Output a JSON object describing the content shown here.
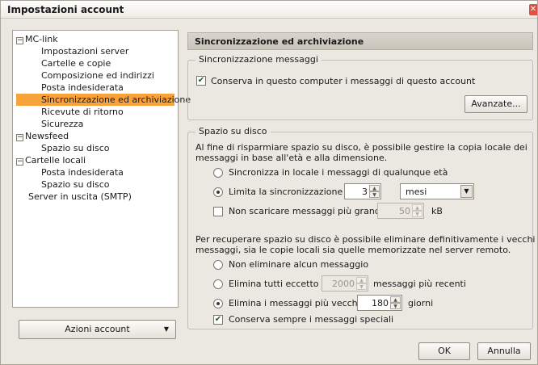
{
  "window": {
    "title": "Impostazioni account",
    "close_glyph": "✕"
  },
  "tree": {
    "items": [
      {
        "label": "MC-link",
        "toggle": "−"
      },
      {
        "label": "Impostazioni server"
      },
      {
        "label": "Cartelle e copie"
      },
      {
        "label": "Composizione ed indirizzi"
      },
      {
        "label": "Posta indesiderata"
      },
      {
        "label": "Sincronizzazione ed archiviazione",
        "selected": true
      },
      {
        "label": "Ricevute di ritorno"
      },
      {
        "label": "Sicurezza"
      },
      {
        "label": "Newsfeed",
        "toggle": "−"
      },
      {
        "label": "Spazio su disco"
      },
      {
        "label": "Cartelle locali",
        "toggle": "−"
      },
      {
        "label": "Posta indesiderata"
      },
      {
        "label": "Spazio su disco"
      },
      {
        "label": "Server in uscita (SMTP)"
      }
    ]
  },
  "account_actions": {
    "label": "Azioni account",
    "caret": "▼"
  },
  "panel": {
    "title": "Sincronizzazione ed archiviazione"
  },
  "sync_messages": {
    "legend": "Sincronizzazione messaggi",
    "keep_checkbox_label": "Conserva in questo computer i messaggi di questo account",
    "keep_checked": true,
    "advanced_button": "Avanzate..."
  },
  "disk_space": {
    "legend": "Spazio su disco",
    "description": [
      "Al fine di risparmiare spazio su disco, è possibile gestire la copia locale dei",
      "messaggi in base all'età e alla dimensione."
    ],
    "radio_any_age": "Sincronizza in locale i messaggi di qualunque età",
    "radio_limit": "Limita la sincronizzazione a",
    "limit_value": "3",
    "limit_unit": "mesi",
    "no_download_label": "Non scaricare messaggi più grandi di",
    "no_download_checked": false,
    "size_value": "50",
    "size_unit": "kB",
    "delete_description": [
      "Per recuperare spazio su disco è possibile eliminare definitivamente i vecchi",
      "messaggi, sia le copie locali sia quelle memorizzate nel server remoto."
    ],
    "radio_no_delete": "Non eliminare alcun messaggio",
    "radio_delete_all": "Elimina tutti eccetto i",
    "delete_all_value": "2000",
    "delete_all_suffix": "messaggi più recenti",
    "radio_delete_older": "Elimina i messaggi più vecchi di",
    "delete_older_value": "180",
    "delete_older_suffix": "giorni",
    "keep_special_label": "Conserva sempre i messaggi speciali",
    "keep_special_checked": true
  },
  "footer": {
    "ok": "OK",
    "cancel": "Annulla"
  }
}
